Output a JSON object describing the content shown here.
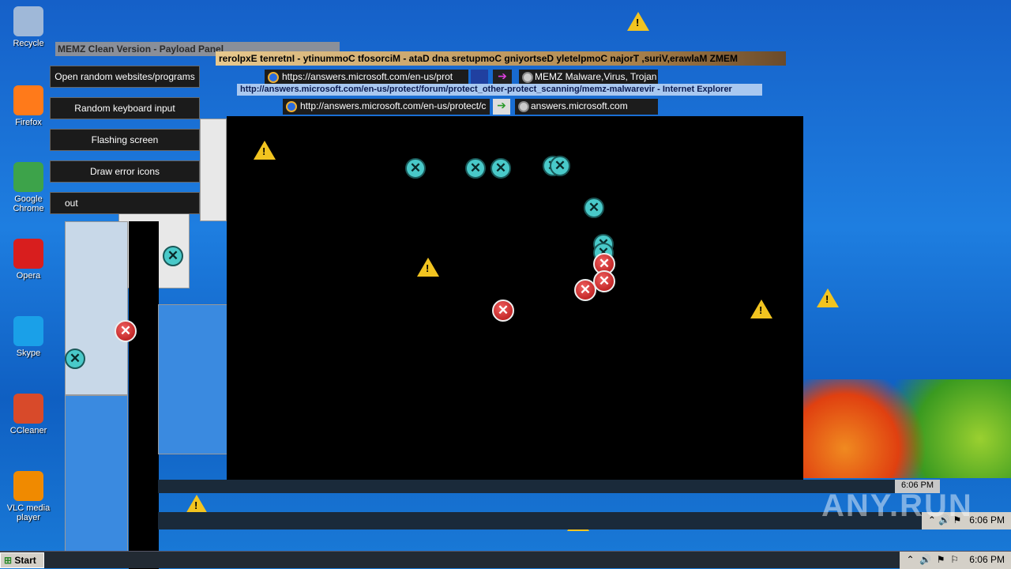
{
  "desktop_icons": [
    {
      "label": "Recycle",
      "icon": "recycle-bin-icon",
      "color": "#9fb8d8"
    },
    {
      "label": "Firefox",
      "icon": "firefox-icon",
      "color": "#ff7a1a"
    },
    {
      "label": "Google Chrome",
      "icon": "chrome-icon",
      "color": "#3da34a"
    },
    {
      "label": "Opera",
      "icon": "opera-icon",
      "color": "#d81e1e"
    },
    {
      "label": "Skype",
      "icon": "skype-icon",
      "color": "#1aa0e8"
    },
    {
      "label": "CCleaner",
      "icon": "ccleaner-icon",
      "color": "#d84a2a"
    },
    {
      "label": "VLC media player",
      "icon": "vlc-icon",
      "color": "#f08a00"
    }
  ],
  "memz_panel": {
    "title": "MEMZ Clean Version - Payload Panel",
    "buttons": [
      "Open random websites/programs",
      "Random keyboard input",
      "Flashing screen",
      "Draw error icons",
      "out"
    ]
  },
  "reversed_title": "rerolpxE tenretnI - ytinummoC tfosorciM - ataD dna sretupmoC gniyortseD yletelpmoC najorT ,suriV,erawlaM ZMEM",
  "browser1": {
    "address": "https://answers.microsoft.com/en-us/prot",
    "tab": "MEMZ Malware,Virus, Trojan ..."
  },
  "ie_title": "http://answers.microsoft.com/en-us/protect/forum/protect_other-protect_scanning/memz-malwarevir - Internet Explorer",
  "browser2": {
    "address": "http://answers.microsoft.com/en-us/protect/c",
    "tab": "answers.microsoft.com"
  },
  "taskbar": {
    "start": "Start",
    "clock": "6:06 PM"
  },
  "watermark": "ANY.RUN",
  "colors": {
    "error_cyan": "#49c9c9",
    "error_red": "#c81e1e",
    "warning": "#f2c420"
  }
}
